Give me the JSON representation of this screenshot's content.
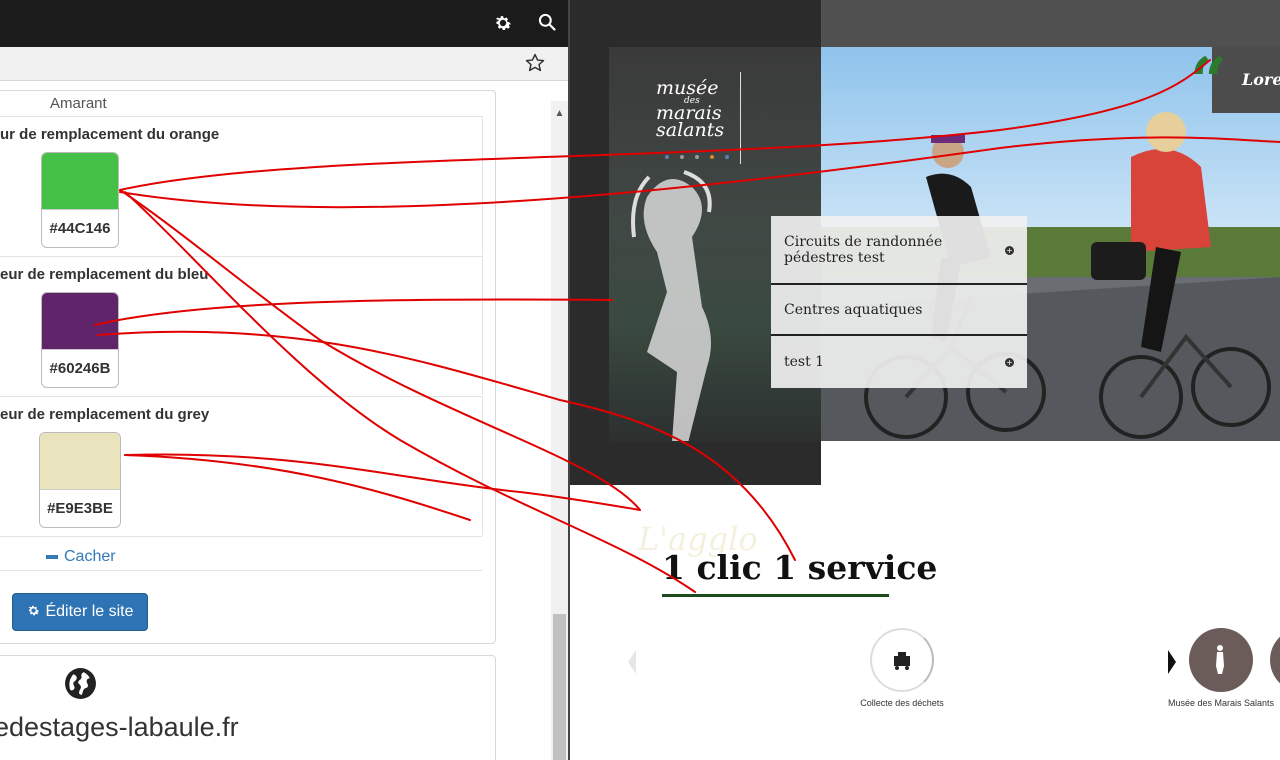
{
  "left_panel": {
    "amarant_text": "Amarant",
    "color_rows": [
      {
        "label": "ur de remplacement du orange",
        "hex": "#44C146",
        "fill": "#44C146"
      },
      {
        "label": "eur de remplacement du bleu",
        "hex": "#60246B",
        "fill": "#60246B"
      },
      {
        "label": "eur de remplacement du grey",
        "hex": "#E9E3BE",
        "fill": "#E9E3BE"
      }
    ],
    "hide_link": "Cacher",
    "edit_button": "Éditer le site",
    "domain": "edestages-labaule.fr"
  },
  "website": {
    "museum_logo": {
      "line1": "musée",
      "small": "des",
      "line2": "marais",
      "line3": "salants"
    },
    "menu_items": [
      {
        "label": "Circuits de randonnée pédestres test",
        "has_plus": true
      },
      {
        "label": "Centres aquatiques",
        "has_plus": false
      },
      {
        "label": "test 1",
        "has_plus": true
      }
    ],
    "quote_text": "Lorem",
    "agglo_text": "L'agglo",
    "headline": "1 clic 1 service",
    "services": [
      {
        "label": "Collecte des déchets",
        "icon": "truck-icon"
      },
      {
        "label": "Musée des Marais Salants",
        "icon": "museum-figure-icon"
      }
    ]
  },
  "colors": {
    "accent_blue": "#2E74B5",
    "link_blue": "#337AB7",
    "dark_green": "#1C4A1C",
    "annotation_red": "#E00000"
  }
}
